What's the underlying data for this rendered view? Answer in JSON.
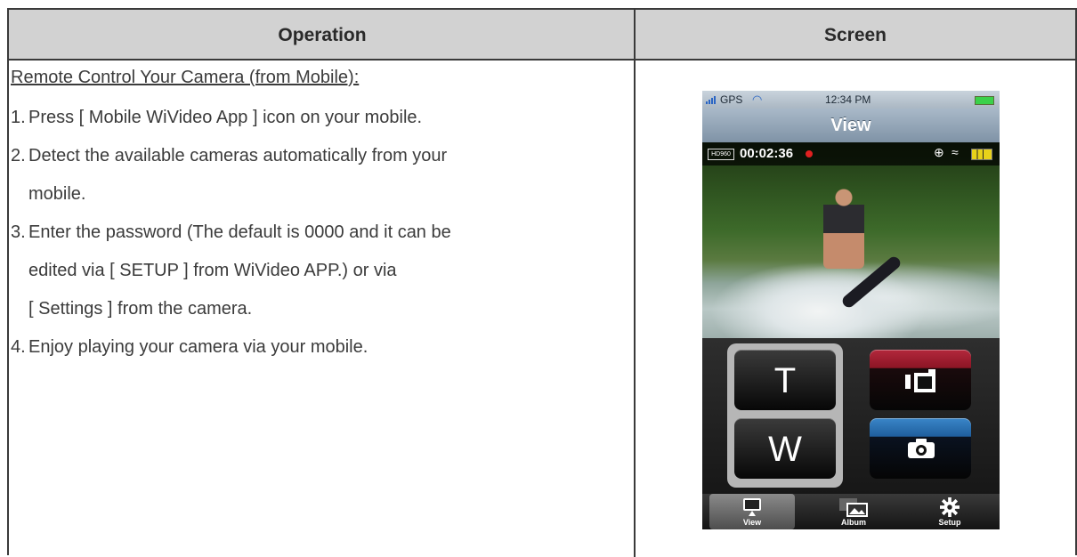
{
  "table": {
    "headers": {
      "operation": "Operation",
      "screen": "Screen"
    },
    "operation": {
      "title": "Remote Control Your Camera (from Mobile):",
      "items": [
        {
          "num": "1.",
          "lines": [
            "Press [ Mobile WiVideo App ] icon on your mobile."
          ]
        },
        {
          "num": "2.",
          "lines": [
            "Detect the available cameras automatically from your",
            "mobile."
          ]
        },
        {
          "num": "3.",
          "lines": [
            "Enter the password (The default is 0000 and it can be",
            "edited via [ SETUP ] from WiVideo APP.) or via",
            "[ Settings ] from the camera."
          ]
        },
        {
          "num": "4.",
          "lines": [
            "Enjoy playing your camera via your mobile."
          ]
        }
      ]
    }
  },
  "phone": {
    "status": {
      "gps": "GPS",
      "time": "12:34 PM"
    },
    "nav_title": "View",
    "osd": {
      "hd_tag": "HD960",
      "rec_time": "00:02:36"
    },
    "buttons": {
      "tele": "T",
      "wide": "W"
    },
    "tabs": [
      {
        "label": "View",
        "icon": "monitor-icon"
      },
      {
        "label": "Album",
        "icon": "album-icon"
      },
      {
        "label": "Setup",
        "icon": "gear-icon"
      }
    ]
  },
  "colors": {
    "header_bg": "#d2d2d2",
    "record_button": "#b3283c",
    "capture_button": "#3a86c8",
    "battery_status": "#3bd14a"
  }
}
